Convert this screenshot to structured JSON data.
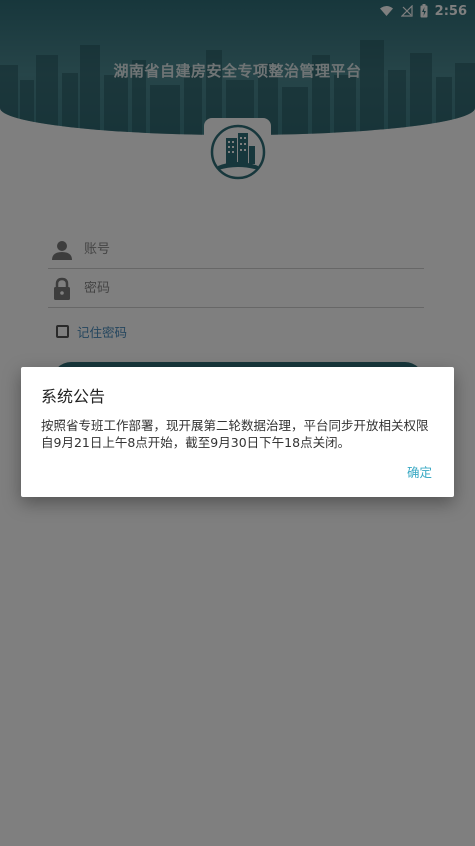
{
  "status_bar": {
    "time": "2:56"
  },
  "header": {
    "title": "湖南省自建房安全专项整治管理平台"
  },
  "login_form": {
    "account_placeholder": "账号",
    "password_placeholder": "密码",
    "remember_label": "记住密码",
    "remember_checked": false,
    "button_color": "#2f6e78"
  },
  "dialog": {
    "title": "系统公告",
    "message": "按照省专班工作部署，现开展第二轮数据治理，平台同步开放相关权限自9月21日上午8点开始，截至9月30日下午18点关闭。",
    "confirm_label": "确定",
    "accent_color": "#39a9c4"
  },
  "icons": [
    "wifi-icon",
    "no-signal-icon",
    "battery-charging-icon",
    "user-icon",
    "lock-icon",
    "logo-building-icon"
  ]
}
